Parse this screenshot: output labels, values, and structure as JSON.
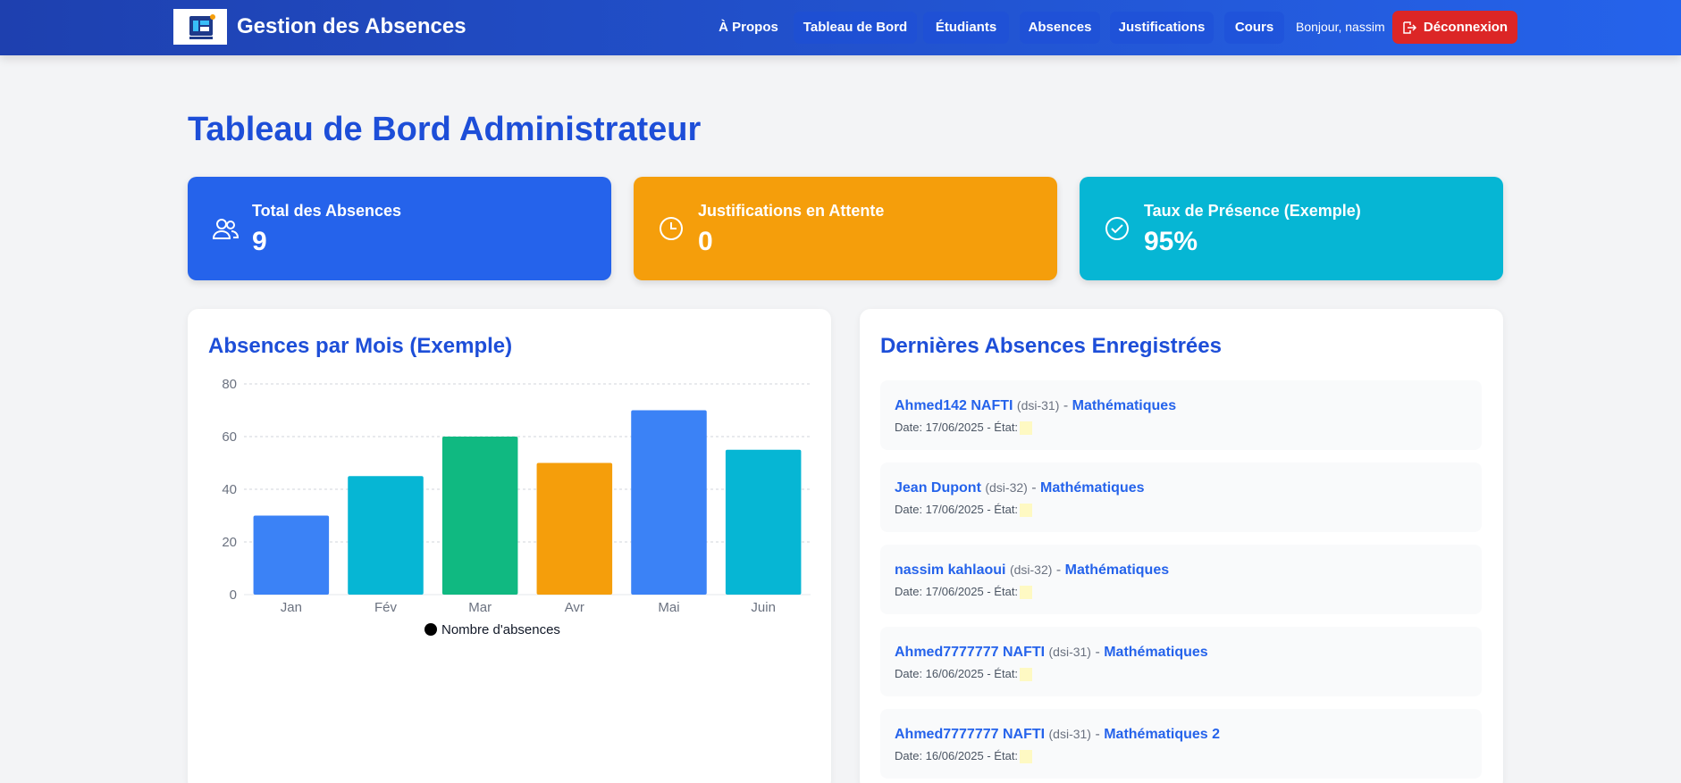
{
  "header": {
    "brand": "Gestion des Absences",
    "nav": [
      {
        "label": "À Propos"
      },
      {
        "label": "Tableau de Bord"
      },
      {
        "label": "Étudiants"
      },
      {
        "label": "Absences"
      },
      {
        "label": "Justifications"
      },
      {
        "label": "Cours"
      }
    ],
    "greeting": "Bonjour, nassim",
    "logout_label": "Déconnexion"
  },
  "page": {
    "title": "Tableau de Bord Administrateur"
  },
  "stats": [
    {
      "label": "Total des Absences",
      "value": "9",
      "color": "#2563eb",
      "icon": "users-icon"
    },
    {
      "label": "Justifications en Attente",
      "value": "0",
      "color": "#f59e0b",
      "icon": "clock-icon"
    },
    {
      "label": "Taux de Présence (Exemple)",
      "value": "95%",
      "color": "#06b6d4",
      "icon": "check-circle-icon"
    }
  ],
  "chart_panel": {
    "title": "Absences par Mois (Exemple)"
  },
  "chart_data": {
    "type": "bar",
    "categories": [
      "Jan",
      "Fév",
      "Mar",
      "Avr",
      "Mai",
      "Juin"
    ],
    "series": [
      {
        "name": "Nombre d'absences",
        "values": [
          30,
          45,
          60,
          50,
          70,
          55
        ]
      }
    ],
    "colors": [
      "#3b82f6",
      "#06b6d4",
      "#10b981",
      "#f59e0b",
      "#3b82f6",
      "#06b6d4"
    ],
    "ylim": [
      0,
      80
    ],
    "yticks": [
      0,
      20,
      40,
      60,
      80
    ],
    "grid": true,
    "legend": "bottom"
  },
  "recent_panel": {
    "title": "Dernières Absences Enregistrées",
    "items": [
      {
        "name": "Ahmed142 NAFTI",
        "class": "(dsi-31)",
        "sep": "-",
        "course": "Mathématiques",
        "date": "Date: 17/06/2025 - État:"
      },
      {
        "name": "Jean Dupont",
        "class": "(dsi-32)",
        "sep": "-",
        "course": "Mathématiques",
        "date": "Date: 17/06/2025 - État:"
      },
      {
        "name": "nassim kahlaoui",
        "class": "(dsi-32)",
        "sep": "-",
        "course": "Mathématiques",
        "date": "Date: 17/06/2025 - État:"
      },
      {
        "name": "Ahmed7777777 NAFTI",
        "class": "(dsi-31)",
        "sep": "-",
        "course": "Mathématiques",
        "date": "Date: 16/06/2025 - État:"
      },
      {
        "name": "Ahmed7777777 NAFTI",
        "class": "(dsi-31)",
        "sep": "-",
        "course": "Mathématiques 2",
        "date": "Date: 16/06/2025 - État:"
      }
    ]
  }
}
